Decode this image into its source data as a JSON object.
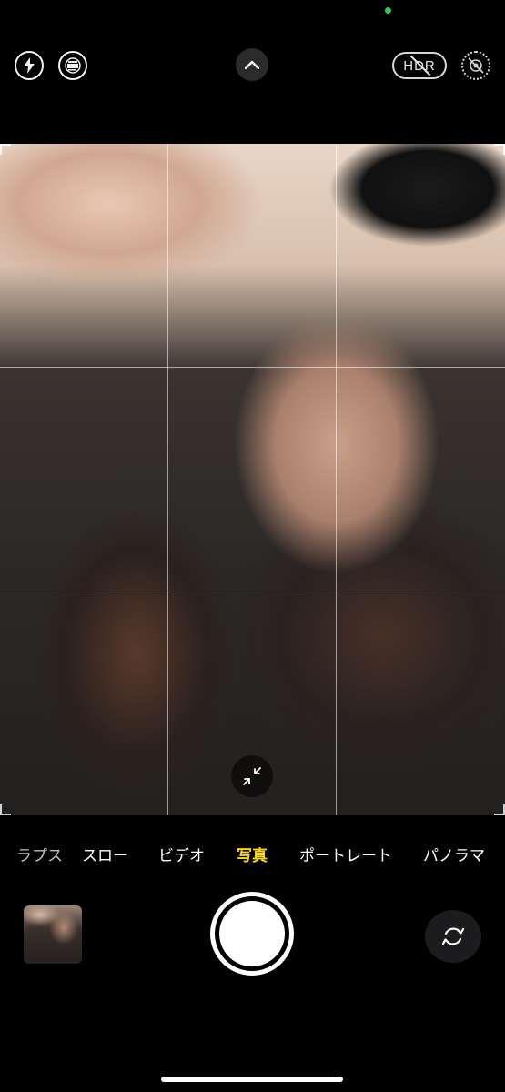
{
  "top_bar": {
    "flash_icon": "bolt-icon",
    "live_photo_icon": "live-photo-icon",
    "expand_icon": "chevron-up-icon",
    "hdr_label": "HDR",
    "timer_icon": "live-off-icon"
  },
  "viewfinder": {
    "collapse_icon": "arrows-in-icon",
    "grid": "3x3"
  },
  "modes": {
    "items": [
      "ラプス",
      "スロー",
      "ビデオ",
      "写真",
      "ポートレート",
      "パノラマ"
    ],
    "active": "写真"
  },
  "controls": {
    "shutter_icon": "shutter-button",
    "switch_icon": "camera-switch-icon"
  },
  "colors": {
    "accent": "#ffd60a",
    "indicator": "#33c759"
  }
}
